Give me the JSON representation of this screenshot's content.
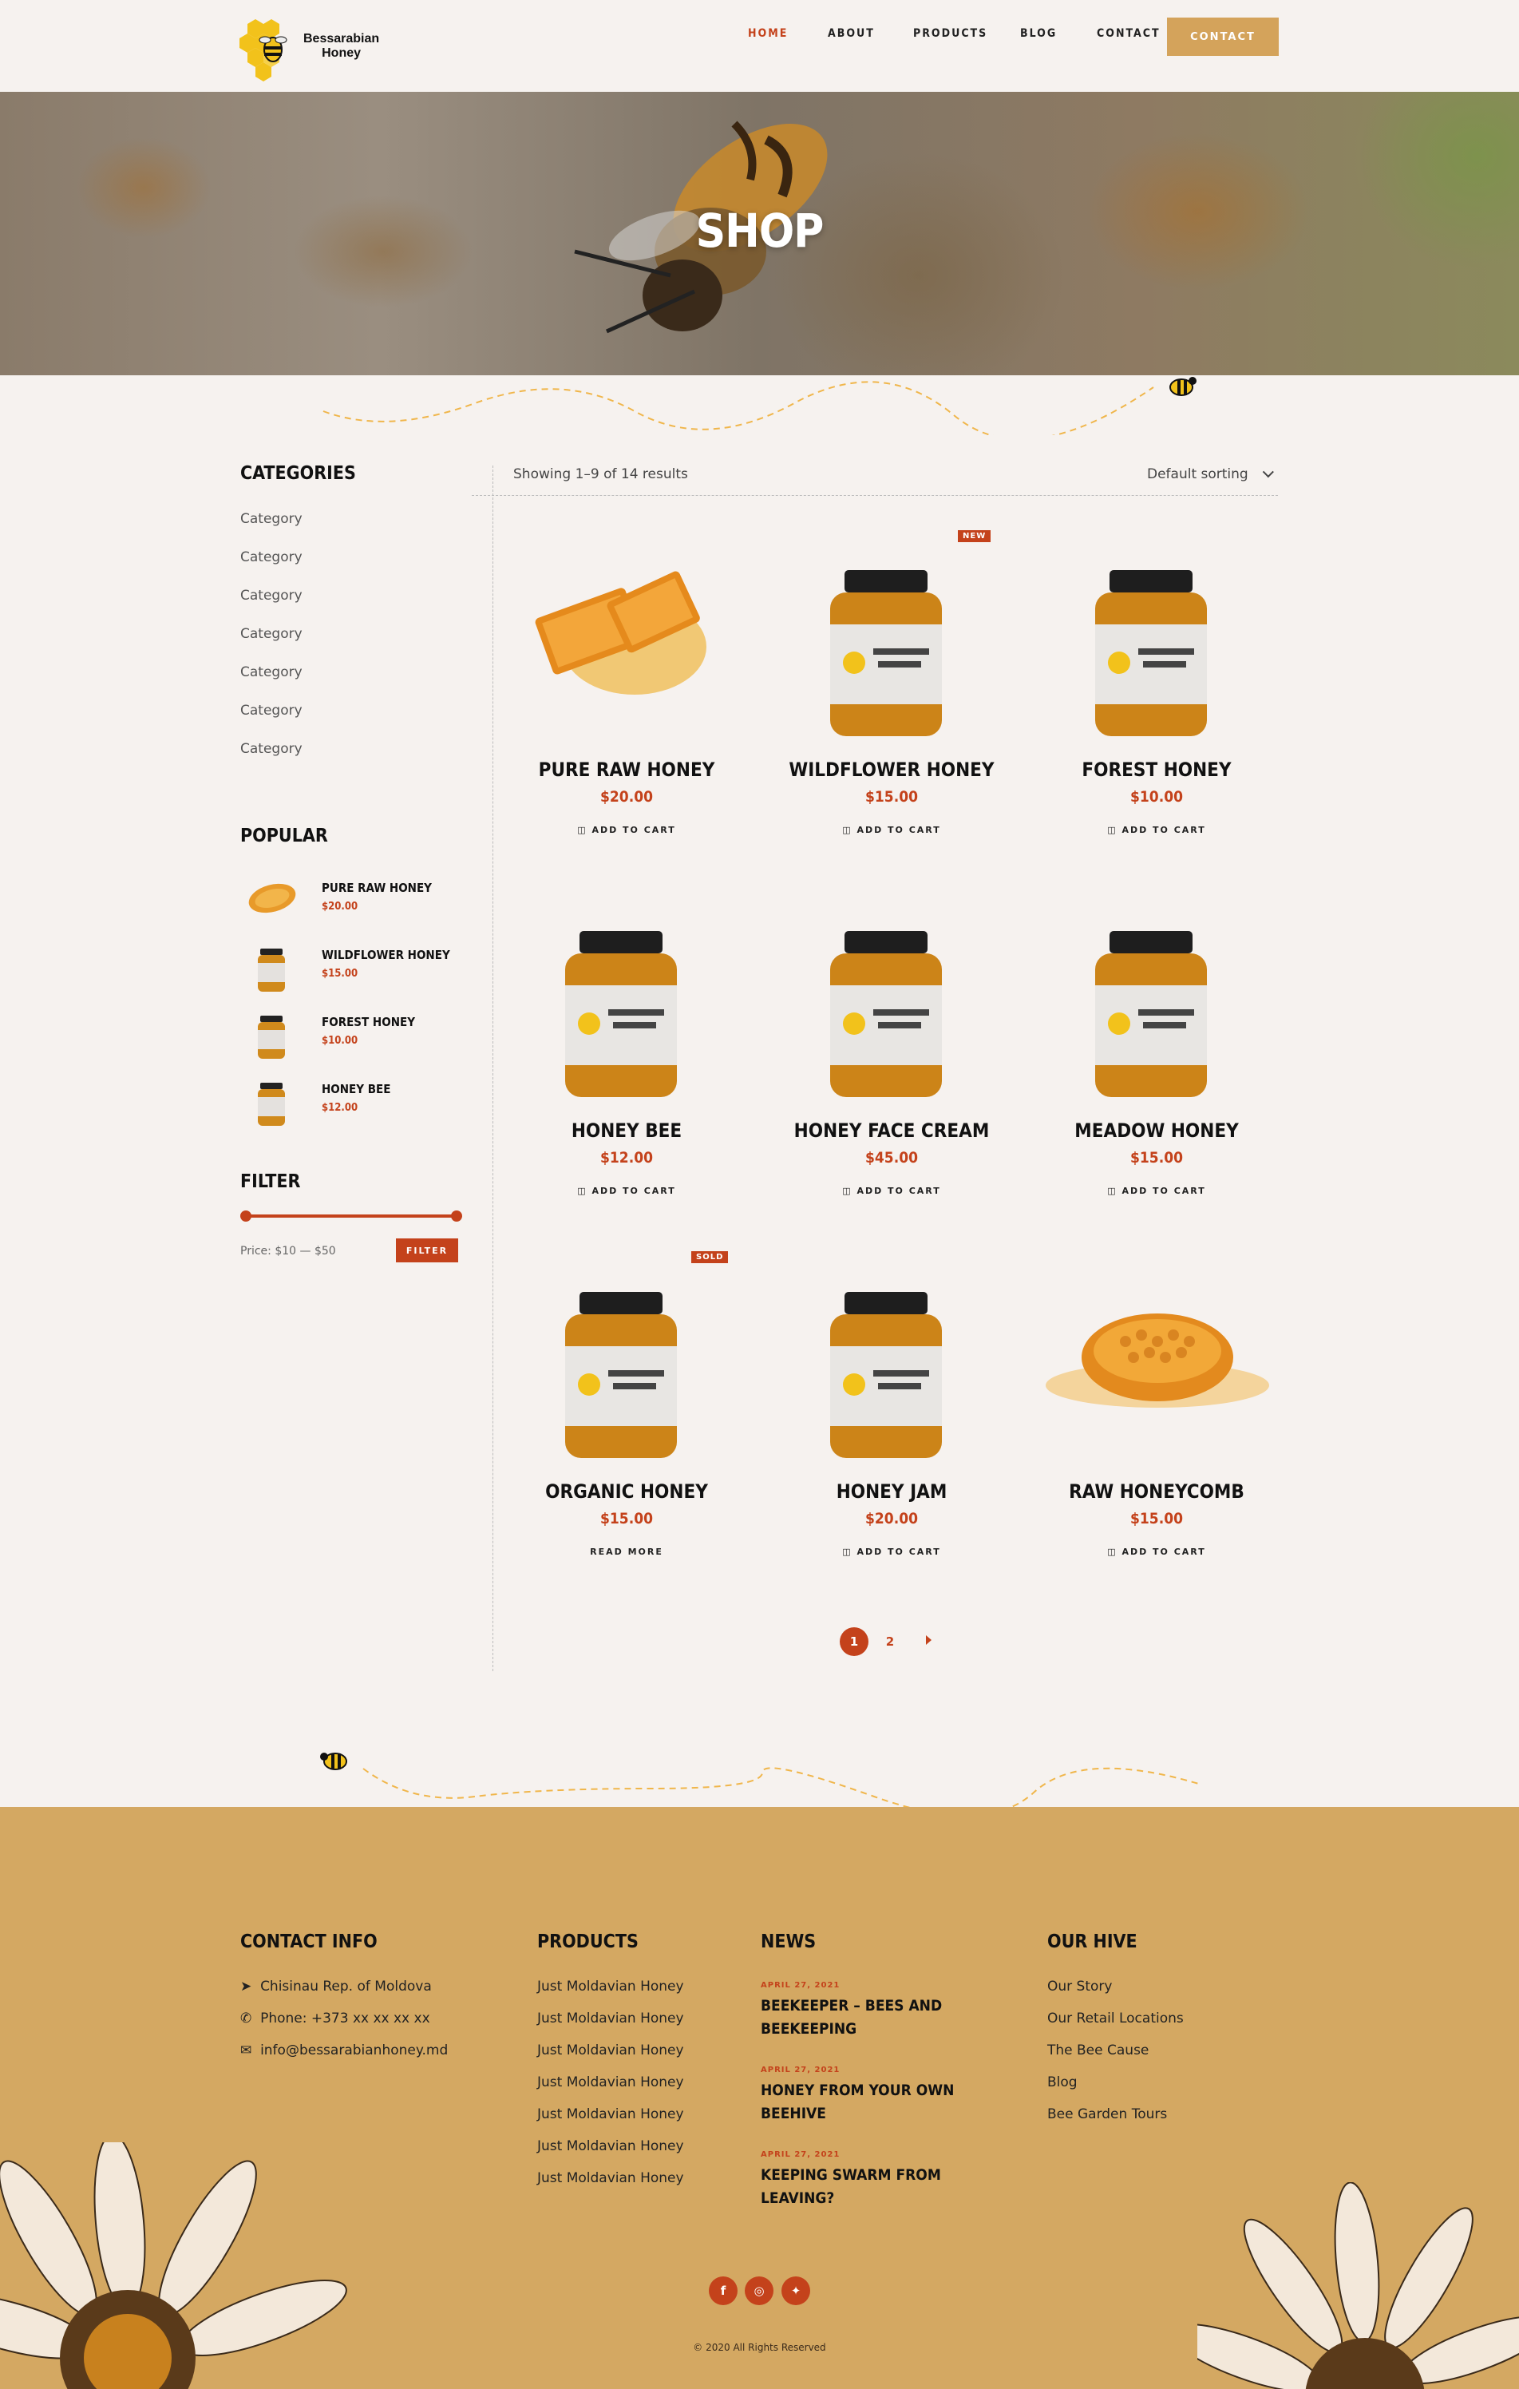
{
  "brand": {
    "line1": "Bessarabian",
    "line2": "Honey"
  },
  "nav": {
    "items": [
      {
        "label": "HOME"
      },
      {
        "label": "ABOUT"
      },
      {
        "label": "PRODUCTS"
      },
      {
        "label": "BLOG"
      },
      {
        "label": "CONTACT"
      }
    ],
    "cta": "CONTACT"
  },
  "hero": {
    "title": "SHOP"
  },
  "sidebar": {
    "categories_title": "CATEGORIES",
    "categories": [
      "Category",
      "Category",
      "Category",
      "Category",
      "Category",
      "Category",
      "Category"
    ],
    "popular_title": "POPULAR",
    "popular": [
      {
        "name": "PURE RAW HONEY",
        "price": "$20.00"
      },
      {
        "name": "WILDFLOWER HONEY",
        "price": "$15.00"
      },
      {
        "name": "FOREST HONEY",
        "price": "$10.00"
      },
      {
        "name": "HONEY BEE",
        "price": "$12.00"
      }
    ],
    "filter_title": "FILTER",
    "filter_price": "Price: $10 — $50",
    "filter_button": "FILTER",
    "filter_range": {
      "min": 10,
      "max": 50
    }
  },
  "shop": {
    "results": "Showing 1–9 of 14 results",
    "sorting": "Default sorting",
    "products": [
      {
        "name": "PURE RAW HONEY",
        "price": "$20.00",
        "action": "ADD TO CART",
        "badge": ""
      },
      {
        "name": "WILDFLOWER HONEY",
        "price": "$15.00",
        "action": "ADD TO CART",
        "badge": "NEW"
      },
      {
        "name": "FOREST HONEY",
        "price": "$10.00",
        "action": "ADD TO CART",
        "badge": ""
      },
      {
        "name": "HONEY BEE",
        "price": "$12.00",
        "action": "ADD TO CART",
        "badge": ""
      },
      {
        "name": "HONEY FACE CREAM",
        "price": "$45.00",
        "action": "ADD TO CART",
        "badge": ""
      },
      {
        "name": "MEADOW HONEY",
        "price": "$15.00",
        "action": "ADD TO CART",
        "badge": ""
      },
      {
        "name": "ORGANIC HONEY",
        "price": "$15.00",
        "action": "READ MORE",
        "badge": "SOLD"
      },
      {
        "name": "HONEY JAM",
        "price": "$20.00",
        "action": "ADD TO CART",
        "badge": ""
      },
      {
        "name": "RAW HONEYCOMB",
        "price": "$15.00",
        "action": "ADD TO CART",
        "badge": ""
      }
    ],
    "pagination": {
      "current": "1",
      "next_page": "2",
      "next_icon": "triangle-right-icon"
    }
  },
  "footer": {
    "contact_title": "CONTACT INFO",
    "address": "Chisinau Rep. of Moldova",
    "phone": "Phone: +373 xx xx xx xx",
    "email": "info@bessarabianhoney.md",
    "products_title": "PRODUCTS",
    "products": [
      "Just Moldavian Honey",
      "Just Moldavian Honey",
      "Just Moldavian Honey",
      "Just Moldavian Honey",
      "Just Moldavian Honey",
      "Just Moldavian Honey",
      "Just Moldavian Honey"
    ],
    "news_title": "NEWS",
    "news": [
      {
        "date": "APRIL 27, 2021",
        "title": "BEEKEEPER – BEES AND BEEKEEPING"
      },
      {
        "date": "APRIL 27, 2021",
        "title": "HONEY FROM YOUR OWN BEEHIVE"
      },
      {
        "date": "APRIL 27, 2021",
        "title": "KEEPING SWARM FROM LEAVING?"
      }
    ],
    "hive_title": "OUR HIVE",
    "hive": [
      "Our Story",
      "Our Retail Locations",
      "The Bee Cause",
      "Blog",
      "Bee Garden Tours"
    ],
    "social": [
      "facebook-icon",
      "instagram-icon",
      "twitter-icon"
    ],
    "copyright": "© 2020 All Rights Reserved"
  },
  "colors": {
    "accent": "#c4421b",
    "gold": "#d4a862",
    "background": "#f6f2ef"
  }
}
